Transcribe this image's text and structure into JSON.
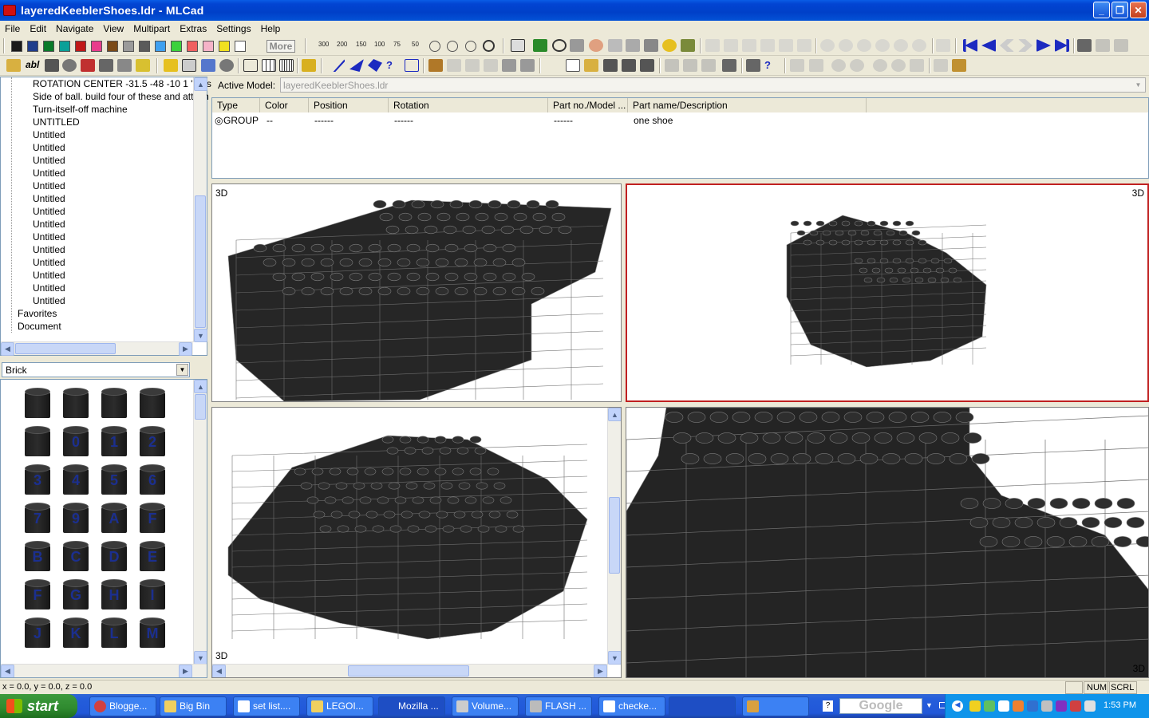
{
  "window": {
    "title": "layeredKeeblerShoes.ldr - MLCad"
  },
  "menu": [
    "File",
    "Edit",
    "Navigate",
    "View",
    "Multipart",
    "Extras",
    "Settings",
    "Help"
  ],
  "toolbar": {
    "colors": [
      "#1a1a1a",
      "#1f3d8c",
      "#0a7a2a",
      "#0aa098",
      "#c01818",
      "#e83c8c",
      "#7a4a18",
      "#9a9a9a",
      "#5a5a5a",
      "#3fa0f0",
      "#3cd23c",
      "#f06060",
      "#f5b3c8",
      "#f0e020",
      "#ffffff"
    ],
    "more_label": "More",
    "zoom_labels": [
      "300",
      "200",
      "150",
      "100",
      "75",
      "50"
    ]
  },
  "tree": {
    "items": [
      "ROTATION CENTER -31.5 -48 -10 1 \"Cust",
      "Side of ball. build four of these and attach",
      "Turn-itself-off machine",
      "UNTITLED",
      "Untitled",
      "Untitled",
      "Untitled",
      "Untitled",
      "Untitled",
      "Untitled",
      "Untitled",
      "Untitled",
      "Untitled",
      "Untitled",
      "Untitled",
      "Untitled",
      "Untitled",
      "Untitled"
    ],
    "root_items": [
      "Favorites",
      "Document"
    ]
  },
  "category": {
    "value": "Brick"
  },
  "parts_grid": {
    "labels": [
      "",
      "",
      "",
      "",
      "",
      "0",
      "1",
      "2",
      "3",
      "4",
      "5",
      "6",
      "7",
      "9",
      "A",
      "F",
      "B",
      "C",
      "D",
      "E",
      "F",
      "G",
      "H",
      "I",
      "J",
      "K",
      "L",
      "M"
    ]
  },
  "active_model": {
    "label": "Active Model:",
    "value": "layeredKeeblerShoes.ldr"
  },
  "parts_table": {
    "columns": [
      "Type",
      "Color",
      "Position",
      "Rotation",
      "Part no./Model ...",
      "Part name/Description"
    ],
    "rows": [
      {
        "type": "GROUP",
        "color": "--",
        "position": "------",
        "rotation": "------",
        "part_no": "------",
        "description": "one shoe"
      }
    ]
  },
  "viewports": {
    "label": "3D"
  },
  "status": {
    "coords": "x = 0.0, y = 0.0, z = 0.0",
    "num": "NUM",
    "scrl": "SCRL"
  },
  "taskbar": {
    "start": "start",
    "tasks": [
      "Blogge...",
      "Big Bin",
      "set list....",
      "LEGOI...",
      "Mozilla ...",
      "Volume...",
      "FLASH ...",
      "checke..."
    ],
    "search_placeholder": "Google",
    "clock": "1:53 PM"
  }
}
